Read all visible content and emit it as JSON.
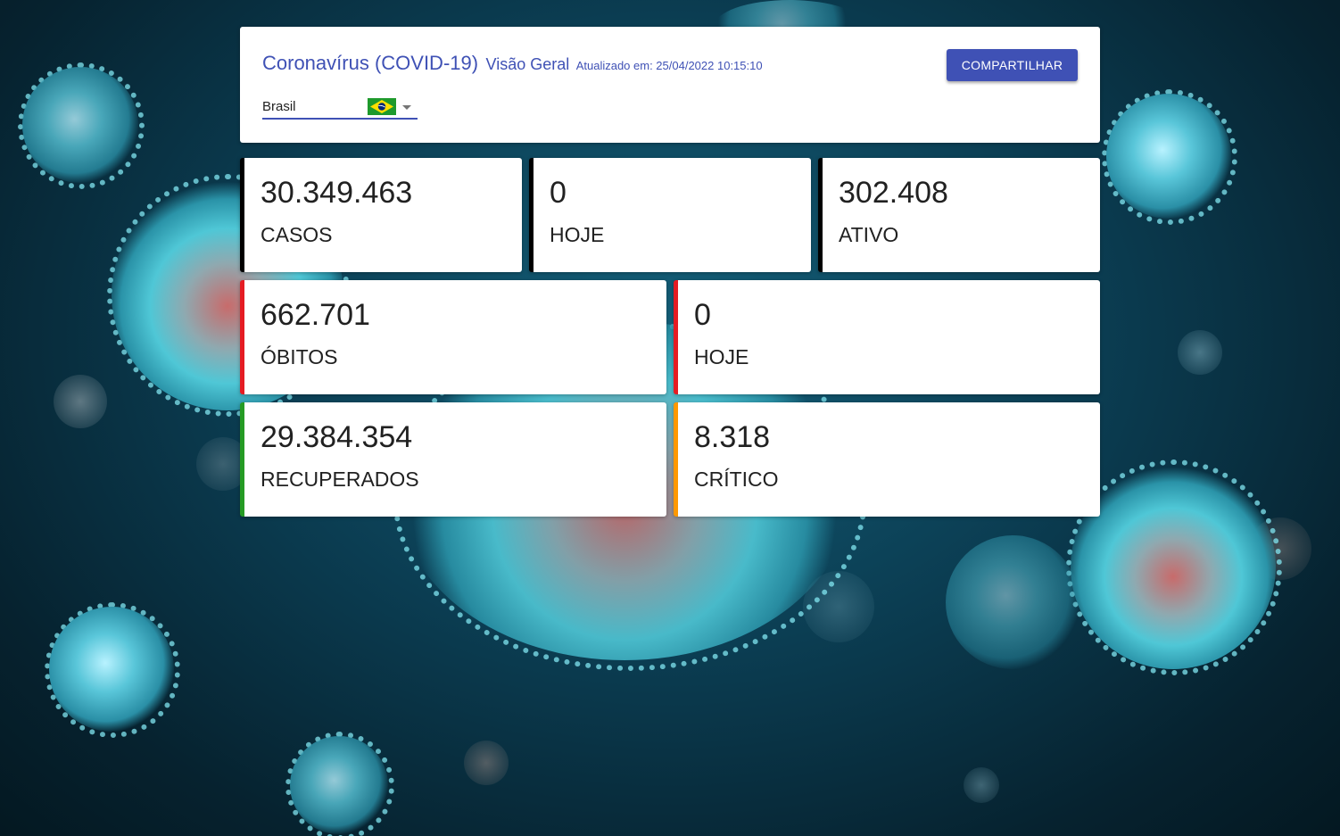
{
  "header": {
    "title": "Coronavírus (COVID-19)",
    "subtitle": "Visão Geral",
    "updated": "Atualizado em: 25/04/2022 10:15:10",
    "share_label": "COMPARTILHAR"
  },
  "country_select": {
    "value": "Brasil",
    "flag_icon": "brazil-flag-icon"
  },
  "stats": {
    "cases": {
      "value": "30.349.463",
      "label": "CASOS",
      "color": "#000000"
    },
    "cases_today": {
      "value": "0",
      "label": "HOJE",
      "color": "#000000"
    },
    "active": {
      "value": "302.408",
      "label": "ATIVO",
      "color": "#000000"
    },
    "deaths": {
      "value": "662.701",
      "label": "ÓBITOS",
      "color": "#e51c23"
    },
    "deaths_today": {
      "value": "0",
      "label": "HOJE",
      "color": "#e51c23"
    },
    "recovered": {
      "value": "29.384.354",
      "label": "RECUPERADOS",
      "color": "#259b24"
    },
    "critical": {
      "value": "8.318",
      "label": "CRÍTICO",
      "color": "#ff9800"
    }
  },
  "colors": {
    "primary": "#3f51b5",
    "black": "#000000",
    "red": "#e51c23",
    "green": "#259b24",
    "orange": "#ff9800"
  }
}
